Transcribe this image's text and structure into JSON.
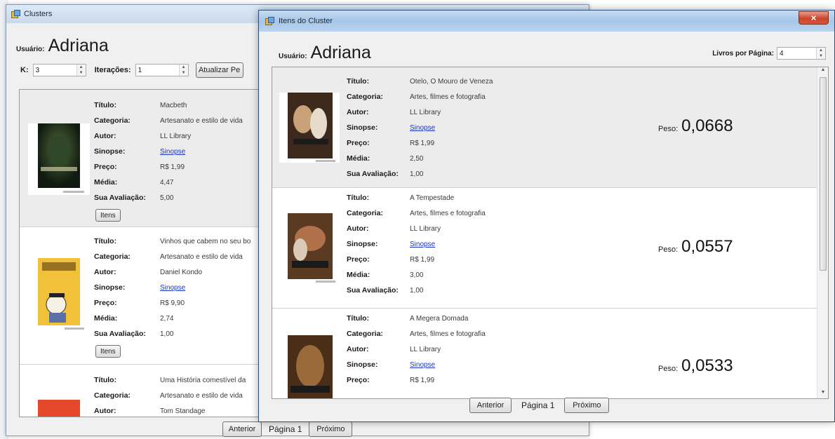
{
  "back_window": {
    "title": "Clusters",
    "user_label": "Usuário:",
    "user_name": "Adriana",
    "k_label": "K:",
    "k_value": "3",
    "iter_label": "Iterações:",
    "iter_value": "1",
    "update_button": "Atualizar Pe",
    "items": [
      {
        "title": "Macbeth",
        "category": "Artesanato e estilo de vida",
        "author": "LL Library",
        "synopsis": "Sinopse",
        "price": "R$ 1,99",
        "average": "4,47",
        "rating": "5,00",
        "items_button": "Itens"
      },
      {
        "title": "Vinhos que cabem no seu bo",
        "category": "Artesanato e estilo de vida",
        "author": "Daniel Kondo",
        "synopsis": "Sinopse",
        "price": "R$ 9,90",
        "average": "2,74",
        "rating": "1,00",
        "items_button": "Itens"
      },
      {
        "title": "Uma História comestível da",
        "category": "Artesanato e estilo de vida",
        "author": "Tom Standage"
      }
    ],
    "nav": {
      "prev": "Anterior",
      "page": "Página 1",
      "next": "Próximo"
    }
  },
  "front_window": {
    "title": "Itens do Cluster",
    "close_symbol": "×",
    "user_label": "Usuário:",
    "user_name": "Adriana",
    "per_page_label": "Livros por Página:",
    "per_page_value": "4",
    "weight_label": "Peso:",
    "items": [
      {
        "title": "Otelo, O Mouro de Veneza",
        "category": "Artes, filmes e fotografia",
        "author": "LL Library",
        "synopsis": "Sinopse",
        "price": "R$ 1,99",
        "average": "2,50",
        "rating": "1,00",
        "weight": "0,0668"
      },
      {
        "title": "A Tempestade",
        "category": "Artes, filmes e fotografia",
        "author": "LL Library",
        "synopsis": "Sinopse",
        "price": "R$ 1,99",
        "average": "3,00",
        "rating": "1,00",
        "weight": "0,0557"
      },
      {
        "title": "A Megera Domada",
        "category": "Artes, filmes e fotografia",
        "author": "LL Library",
        "synopsis": "Sinopse",
        "price": "R$ 1,99",
        "weight": "0,0533"
      }
    ],
    "nav": {
      "prev": "Anterior",
      "page": "Página 1",
      "next": "Próximo"
    }
  },
  "labels": {
    "title": "Título:",
    "category": "Categoria:",
    "author": "Autor:",
    "synopsis": "Sinopse:",
    "price": "Preço:",
    "average": "Média:",
    "rating": "Sua Avaliação:"
  }
}
